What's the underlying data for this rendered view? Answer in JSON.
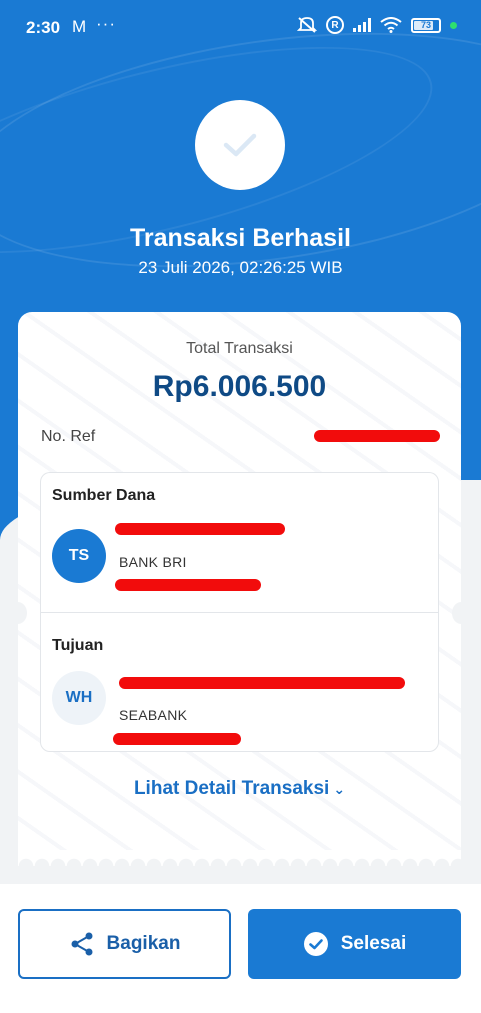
{
  "status_bar": {
    "time": "2:30",
    "mail_icon": "M",
    "dots": "···",
    "battery": "73"
  },
  "header": {
    "title": "Transaksi Berhasil",
    "datetime": "23 Juli 2026, 02:26:25 WIB"
  },
  "summary": {
    "total_label": "Total Transaksi",
    "total_amount": "Rp6.006.500",
    "ref_label": "No. Ref"
  },
  "source": {
    "heading": "Sumber Dana",
    "initials": "TS",
    "bank": "BANK BRI"
  },
  "destination": {
    "heading": "Tujuan",
    "initials": "WH",
    "bank": "SEABANK"
  },
  "detail_link": "Lihat Detail Transaksi",
  "buttons": {
    "share": "Bagikan",
    "done": "Selesai"
  },
  "colors": {
    "primary": "#1a7ad3",
    "amount": "#0f4a85",
    "redaction": "#f20c0c"
  }
}
